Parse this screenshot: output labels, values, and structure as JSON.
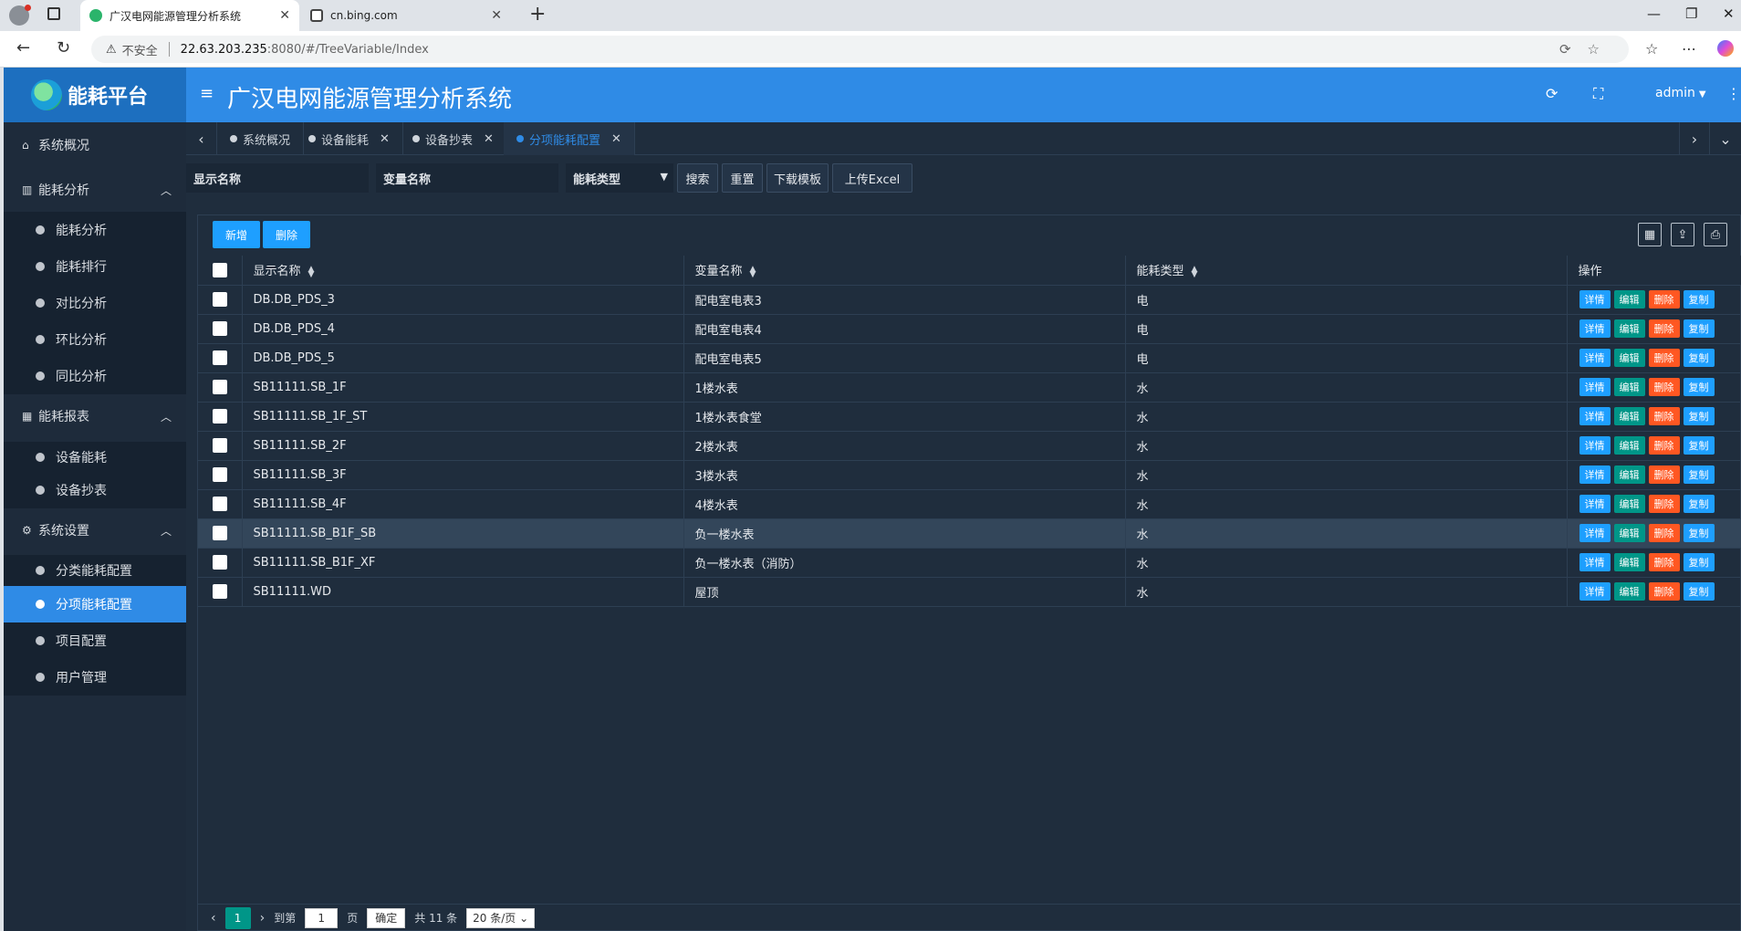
{
  "browser": {
    "tabs": [
      {
        "title": "广汉电网能源管理分析系统",
        "active": true
      },
      {
        "title": "cn.bing.com",
        "active": false
      }
    ],
    "address": {
      "security": "不安全",
      "host": "22.63.203.235",
      "path": ":8080/#/TreeVariable/Index"
    }
  },
  "header": {
    "brand": "能耗平台",
    "title": "广汉电网能源管理分析系统",
    "user": "admin"
  },
  "sidebar": {
    "top_item": "系统概况",
    "groups": [
      {
        "label": "能耗分析",
        "items": [
          "能耗分析",
          "能耗排行",
          "对比分析",
          "环比分析",
          "同比分析"
        ]
      },
      {
        "label": "能耗报表",
        "items": [
          "设备能耗",
          "设备抄表"
        ]
      },
      {
        "label": "系统设置",
        "items": [
          "分类能耗配置",
          "分项能耗配置",
          "项目配置",
          "用户管理"
        ]
      }
    ]
  },
  "page_tabs": [
    {
      "label": "系统概况"
    },
    {
      "label": "设备能耗"
    },
    {
      "label": "设备抄表"
    },
    {
      "label": "分项能耗配置"
    }
  ],
  "search": {
    "field1": "显示名称",
    "field2": "变量名称",
    "select": "能耗类型",
    "buttons": [
      "搜索",
      "重置",
      "下载模板",
      "上传Excel"
    ]
  },
  "toolbar": {
    "add": "新增",
    "delete": "删除"
  },
  "table": {
    "columns": [
      "显示名称",
      "变量名称",
      "能耗类型",
      "操作"
    ],
    "actions": [
      "详情",
      "编辑",
      "删除",
      "复制"
    ],
    "rows": [
      {
        "display": "DB.DB_PDS_3",
        "variable": "配电室电表3",
        "type": "电"
      },
      {
        "display": "DB.DB_PDS_4",
        "variable": "配电室电表4",
        "type": "电"
      },
      {
        "display": "DB.DB_PDS_5",
        "variable": "配电室电表5",
        "type": "电"
      },
      {
        "display": "SB11111.SB_1F",
        "variable": "1楼水表",
        "type": "水"
      },
      {
        "display": "SB11111.SB_1F_ST",
        "variable": "1楼水表食堂",
        "type": "水"
      },
      {
        "display": "SB11111.SB_2F",
        "variable": "2楼水表",
        "type": "水"
      },
      {
        "display": "SB11111.SB_3F",
        "variable": "3楼水表",
        "type": "水"
      },
      {
        "display": "SB11111.SB_4F",
        "variable": "4楼水表",
        "type": "水"
      },
      {
        "display": "SB11111.SB_B1F_SB",
        "variable": "负一楼水表",
        "type": "水"
      },
      {
        "display": "SB11111.SB_B1F_XF",
        "variable": "负一楼水表（消防）",
        "type": "水"
      },
      {
        "display": "SB11111.WD",
        "variable": "屋顶",
        "type": "水"
      }
    ]
  },
  "pager": {
    "current": "1",
    "goto_label": "到第",
    "goto_value": "1",
    "page_unit": "页",
    "confirm": "确定",
    "total": "共 11 条",
    "page_size": "20 条/页"
  },
  "colors": {
    "accent": "#2f8be6",
    "bg": "#1f2d3d",
    "sidebar": "#1e2b3b",
    "edit": "#009688",
    "delete": "#ff5722",
    "info": "#1e9fff"
  }
}
